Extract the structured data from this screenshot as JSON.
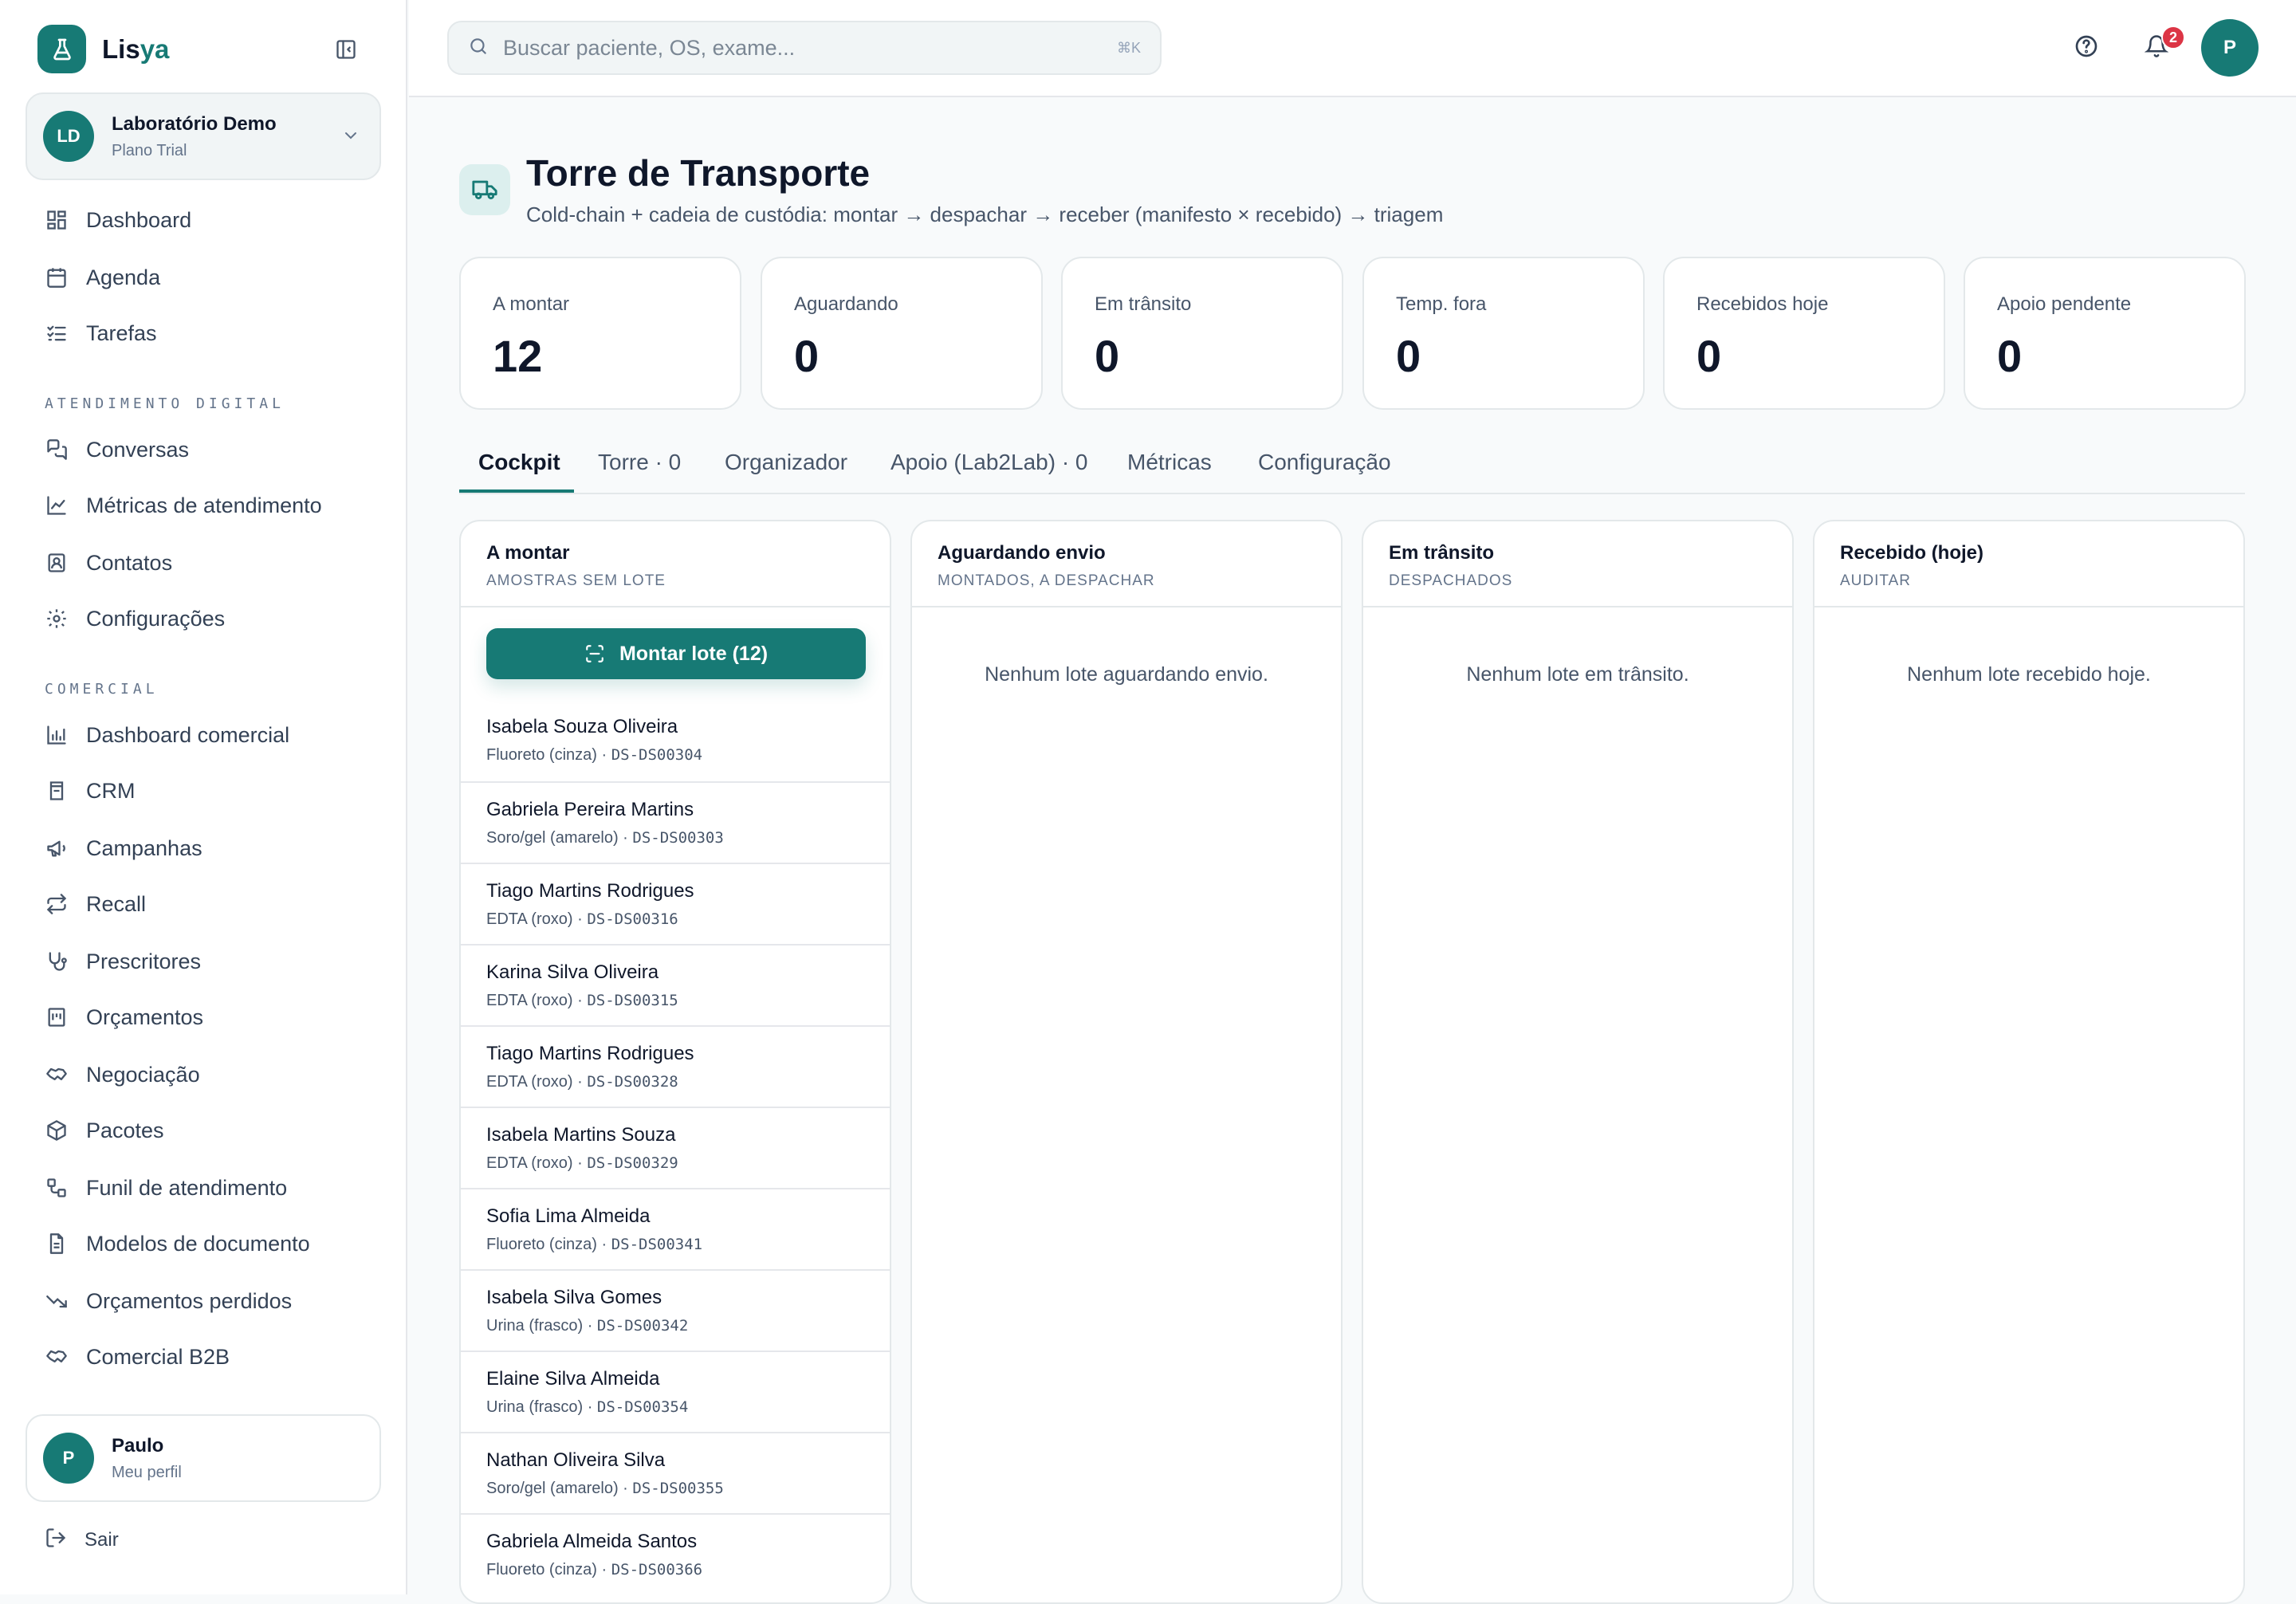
{
  "brand": {
    "name_main": "Lis",
    "name_accent": "ya"
  },
  "org": {
    "initials": "LD",
    "name": "Laboratório Demo",
    "plan": "Plano Trial"
  },
  "nav": {
    "dashboard": "Dashboard",
    "agenda": "Agenda",
    "tarefas": "Tarefas",
    "section_digital": "ATENDIMENTO DIGITAL",
    "conversas": "Conversas",
    "metricas_atendimento": "Métricas de atendimento",
    "contatos": "Contatos",
    "configuracoes": "Configurações",
    "section_comercial": "COMERCIAL",
    "dashboard_comercial": "Dashboard comercial",
    "crm": "CRM",
    "campanhas": "Campanhas",
    "recall": "Recall",
    "prescritores": "Prescritores",
    "orcamentos": "Orçamentos",
    "negociacao": "Negociação",
    "pacotes": "Pacotes",
    "funil": "Funil de atendimento",
    "modelos": "Modelos de documento",
    "orcamentos_perdidos": "Orçamentos perdidos",
    "comercial_b2b": "Comercial B2B"
  },
  "user": {
    "initial": "P",
    "name": "Paulo",
    "sub": "Meu perfil",
    "logout": "Sair"
  },
  "topbar": {
    "search_placeholder": "Buscar paciente, OS, exame...",
    "search_shortcut": "⌘K",
    "notifications_count": "2",
    "avatar_initial": "P"
  },
  "page": {
    "title": "Torre de Transporte",
    "subtitle": "Cold-chain + cadeia de custódia: montar → despachar → receber (manifesto × recebido) → triagem"
  },
  "stats": [
    {
      "label": "A montar",
      "value": "12"
    },
    {
      "label": "Aguardando",
      "value": "0"
    },
    {
      "label": "Em trânsito",
      "value": "0"
    },
    {
      "label": "Temp. fora",
      "value": "0"
    },
    {
      "label": "Recebidos hoje",
      "value": "0"
    },
    {
      "label": "Apoio pendente",
      "value": "0"
    }
  ],
  "tabs": {
    "cockpit": "Cockpit",
    "torre": "Torre · 0",
    "organizador": "Organizador",
    "apoio": "Apoio (Lab2Lab) · 0",
    "metricas": "Métricas",
    "configuracao": "Configuração"
  },
  "columns": {
    "montar": {
      "title": "A montar",
      "sub": "AMOSTRAS SEM LOTE",
      "button": "Montar lote (12)"
    },
    "aguardando": {
      "title": "Aguardando envio",
      "sub": "MONTADOS, A DESPACHAR",
      "empty": "Nenhum lote aguardando envio."
    },
    "transito": {
      "title": "Em trânsito",
      "sub": "DESPACHADOS",
      "empty": "Nenhum lote em trânsito."
    },
    "recebido": {
      "title": "Recebido (hoje)",
      "sub": "AUDITAR",
      "empty": "Nenhum lote recebido hoje."
    }
  },
  "samples": [
    {
      "name": "Isabela Souza Oliveira",
      "tube": "Fluoreto (cinza)",
      "code": "DS-DS00304"
    },
    {
      "name": "Gabriela Pereira Martins",
      "tube": "Soro/gel (amarelo)",
      "code": "DS-DS00303"
    },
    {
      "name": "Tiago Martins Rodrigues",
      "tube": "EDTA (roxo)",
      "code": "DS-DS00316"
    },
    {
      "name": "Karina Silva Oliveira",
      "tube": "EDTA (roxo)",
      "code": "DS-DS00315"
    },
    {
      "name": "Tiago Martins Rodrigues",
      "tube": "EDTA (roxo)",
      "code": "DS-DS00328"
    },
    {
      "name": "Isabela Martins Souza",
      "tube": "EDTA (roxo)",
      "code": "DS-DS00329"
    },
    {
      "name": "Sofia Lima Almeida",
      "tube": "Fluoreto (cinza)",
      "code": "DS-DS00341"
    },
    {
      "name": "Isabela Silva Gomes",
      "tube": "Urina (frasco)",
      "code": "DS-DS00342"
    },
    {
      "name": "Elaine Silva Almeida",
      "tube": "Urina (frasco)",
      "code": "DS-DS00354"
    },
    {
      "name": "Nathan Oliveira Silva",
      "tube": "Soro/gel (amarelo)",
      "code": "DS-DS00355"
    },
    {
      "name": "Gabriela Almeida Santos",
      "tube": "Fluoreto (cinza)",
      "code": "DS-DS00366"
    }
  ],
  "colors": {
    "accent": "#177a75",
    "badge": "#dc3545"
  }
}
